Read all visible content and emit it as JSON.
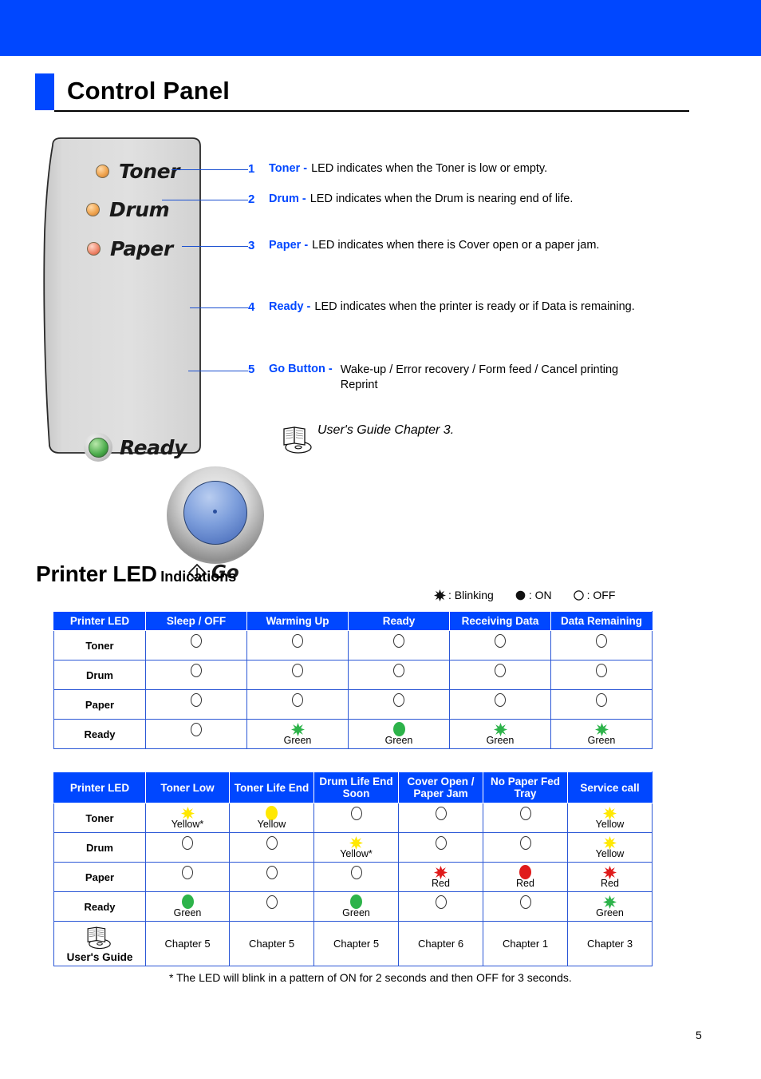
{
  "page": {
    "title": "Control Panel",
    "page_number": "5",
    "accent_blue": "#0047FF"
  },
  "control_panel": {
    "leds": [
      {
        "name": "Toner",
        "color": "amber"
      },
      {
        "name": "Drum",
        "color": "amber"
      },
      {
        "name": "Paper",
        "color": "red"
      },
      {
        "name": "Ready",
        "color": "green"
      }
    ],
    "button_label": "Go",
    "button_icon": "power-go-icon"
  },
  "callouts": [
    {
      "num": "1",
      "term": "Toner -",
      "desc": "LED indicates when the Toner is low or empty."
    },
    {
      "num": "2",
      "term": "Drum -",
      "desc": "LED indicates when the Drum is nearing end of life."
    },
    {
      "num": "3",
      "term": "Paper -",
      "desc": "LED indicates when there is Cover open or a paper jam."
    },
    {
      "num": "4",
      "term": "Ready -",
      "desc": "LED indicates when the printer is ready or if Data is remaining."
    },
    {
      "num": "5",
      "term": "Go Button -",
      "desc_line1": "Wake-up / Error recovery / Form feed / Cancel printing",
      "desc_line2": "Reprint"
    }
  ],
  "guide_note": {
    "icon": "book-cd-icon",
    "text": "User's Guide Chapter 3."
  },
  "led_section": {
    "heading_main": "Printer LED",
    "heading_sub": "Indications",
    "legend": [
      {
        "symbol": "blinking-icon",
        "text": ": Blinking"
      },
      {
        "symbol": "on-icon",
        "text": ": ON"
      },
      {
        "symbol": "off-icon",
        "text": ": OFF"
      }
    ]
  },
  "table1": {
    "headers": [
      "Printer LED",
      "Sleep / OFF",
      "Warming Up",
      "Ready",
      "Receiving Data",
      "Data Remaining"
    ],
    "rows": [
      {
        "label": "Toner",
        "cells": [
          {
            "state": "off"
          },
          {
            "state": "off"
          },
          {
            "state": "off"
          },
          {
            "state": "off"
          },
          {
            "state": "off"
          }
        ]
      },
      {
        "label": "Drum",
        "cells": [
          {
            "state": "off"
          },
          {
            "state": "off"
          },
          {
            "state": "off"
          },
          {
            "state": "off"
          },
          {
            "state": "off"
          }
        ]
      },
      {
        "label": "Paper",
        "cells": [
          {
            "state": "off"
          },
          {
            "state": "off"
          },
          {
            "state": "off"
          },
          {
            "state": "off"
          },
          {
            "state": "off"
          }
        ]
      },
      {
        "label": "Ready",
        "cells": [
          {
            "state": "off"
          },
          {
            "state": "blink",
            "color": "green",
            "label": "Green"
          },
          {
            "state": "on",
            "color": "green",
            "label": "Green"
          },
          {
            "state": "blink",
            "color": "green",
            "label": "Green"
          },
          {
            "state": "blink",
            "color": "green",
            "label": "Green"
          }
        ]
      }
    ]
  },
  "table2": {
    "headers": [
      "Printer LED",
      "Toner Low",
      "Toner Life End",
      "Drum Life End Soon",
      "Cover Open / Paper Jam",
      "No Paper Fed Tray",
      "Service call"
    ],
    "rows": [
      {
        "label": "Toner",
        "cells": [
          {
            "state": "blink",
            "color": "yellow",
            "label": "Yellow*"
          },
          {
            "state": "on",
            "color": "yellow",
            "label": "Yellow"
          },
          {
            "state": "off"
          },
          {
            "state": "off"
          },
          {
            "state": "off"
          },
          {
            "state": "blink",
            "color": "yellow",
            "label": "Yellow"
          }
        ]
      },
      {
        "label": "Drum",
        "cells": [
          {
            "state": "off"
          },
          {
            "state": "off"
          },
          {
            "state": "blink",
            "color": "yellow",
            "label": "Yellow*"
          },
          {
            "state": "off"
          },
          {
            "state": "off"
          },
          {
            "state": "blink",
            "color": "yellow",
            "label": "Yellow"
          }
        ]
      },
      {
        "label": "Paper",
        "cells": [
          {
            "state": "off"
          },
          {
            "state": "off"
          },
          {
            "state": "off"
          },
          {
            "state": "blink",
            "color": "red",
            "label": "Red"
          },
          {
            "state": "on",
            "color": "red",
            "label": "Red"
          },
          {
            "state": "blink",
            "color": "red",
            "label": "Red"
          }
        ]
      },
      {
        "label": "Ready",
        "cells": [
          {
            "state": "on",
            "color": "green",
            "label": "Green"
          },
          {
            "state": "off"
          },
          {
            "state": "on",
            "color": "green",
            "label": "Green"
          },
          {
            "state": "off"
          },
          {
            "state": "off"
          },
          {
            "state": "blink",
            "color": "green",
            "label": "Green"
          }
        ]
      }
    ],
    "guide_row": {
      "label": "User's Guide",
      "icon": "book-cd-icon",
      "cells": [
        "Chapter 5",
        "Chapter 5",
        "Chapter 5",
        "Chapter 6",
        "Chapter 1",
        "Chapter 3"
      ]
    }
  },
  "footnote": "* The LED will blink in a pattern of ON for 2 seconds and then OFF for 3 seconds."
}
